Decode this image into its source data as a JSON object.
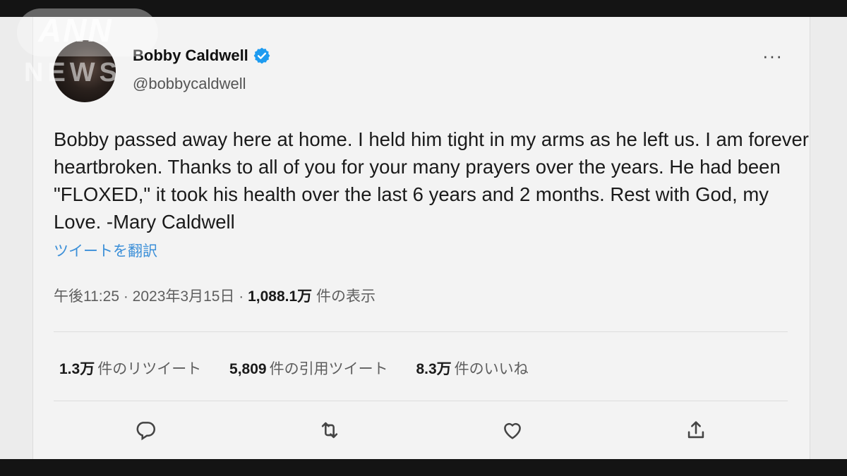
{
  "user": {
    "display_name": "Bobby Caldwell",
    "handle": "@bobbycaldwell",
    "verified_icon": "verified-badge-icon",
    "more_icon": "more-options-icon",
    "more_label": "···"
  },
  "tweet": {
    "text": "Bobby passed away here at home.  I held him tight in my arms as he left us.  I am forever heartbroken.  Thanks to all of you for your many prayers over the years.  He had been \"FLOXED,\" it took his health over the last 6 years and 2 months.  Rest with God, my Love. -Mary Caldwell",
    "translate_label": "ツイートを翻訳"
  },
  "meta": {
    "time": "午後11:25",
    "sep1": " · ",
    "date": "2023年3月15日",
    "sep2": " · ",
    "views_count": "1,088.1万",
    "views_label": " 件の表示"
  },
  "stats": [
    {
      "count": "1.3万",
      "label": "件のリツイート"
    },
    {
      "count": "5,809",
      "label": "件の引用ツイート"
    },
    {
      "count": "8.3万",
      "label": "件のいいね"
    }
  ],
  "actions": [
    "reply-icon",
    "retweet-icon",
    "like-icon",
    "share-icon"
  ],
  "watermark": {
    "top": "ANN",
    "bottom": "NEWS"
  },
  "colors": {
    "accent": "#3b8fd8",
    "verified": "#1d9bf0",
    "icon": "#444444"
  }
}
